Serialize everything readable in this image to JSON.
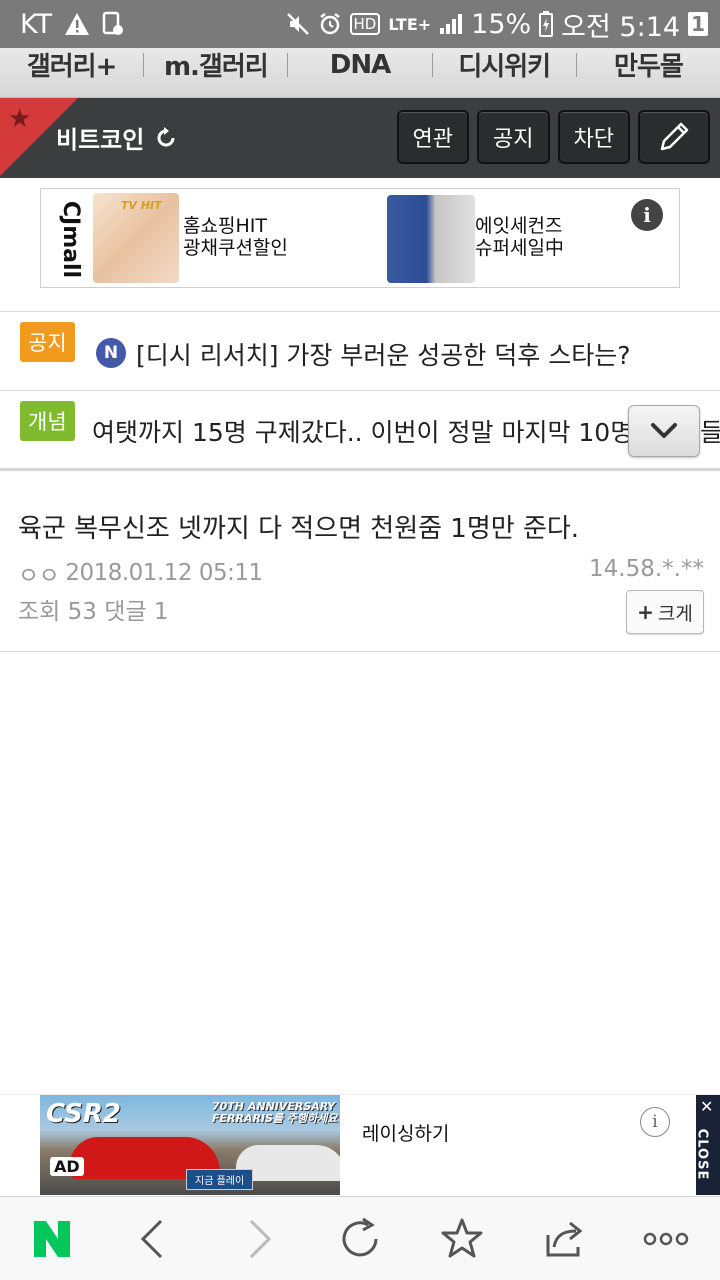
{
  "status_bar": {
    "carrier": "KT",
    "battery": "15%",
    "time": "오전 5:14",
    "notification_count": "1",
    "network": "LTE+",
    "hd": "HD"
  },
  "gallery_nav": {
    "items": [
      "갤러리+",
      "m.갤러리",
      "DNA",
      "디시위키",
      "만두몰"
    ]
  },
  "gallery_header": {
    "title": "비트코인",
    "buttons": [
      "연관",
      "공지",
      "차단"
    ]
  },
  "top_ad": {
    "brand": "CJmall",
    "badge": "TV HIT",
    "item1_line1": "홈쇼핑HIT",
    "item1_line2": "광채쿠션할인",
    "item2_line1": "에잇세컨즈",
    "item2_line2": "슈퍼세일中",
    "info": "i"
  },
  "notice_row": {
    "tag": "공지",
    "badge": "N",
    "text": "[디시 리서치] 가장 부러운 성공한 덕후 스타는?"
  },
  "concept_row": {
    "tag": "개념",
    "text": "여탯까지 15명 구제갔다.. 이번이 정말 마지막 10명이",
    "overflow": "들"
  },
  "post": {
    "title": "육군 복무신조 넷까지 다 적으면 천원줌 1명만 준다.",
    "author": "ㅇㅇ",
    "date": "2018.01.12 05:11",
    "ip": "14.58.*.**",
    "stats": "조회 53 댓글 1",
    "zoom_label": "크게"
  },
  "bottom_ad": {
    "game_logo": "CSR2",
    "promo_line1": "70TH ANNIVERSARY",
    "promo_line2": "FERRARIS를 주행하세요",
    "play_label": "지금 플레이",
    "ad_mark": "AD",
    "cta": "레이싱하기",
    "info": "i",
    "close_label": "CLOSE"
  },
  "browser_bar": {
    "home_label": "N"
  },
  "colors": {
    "status_bg": "#7a7a7a",
    "header_bg": "#3c3d3f",
    "notice_tag": "#f09a1e",
    "concept_tag": "#7fbb2c",
    "n_badge": "#4459a8",
    "naver_green": "#03c75a"
  }
}
